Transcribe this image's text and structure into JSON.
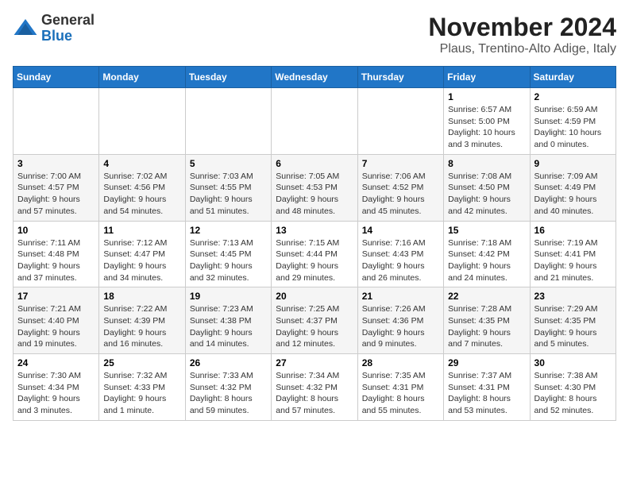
{
  "header": {
    "logo_general": "General",
    "logo_blue": "Blue",
    "month_title": "November 2024",
    "location": "Plaus, Trentino-Alto Adige, Italy"
  },
  "weekdays": [
    "Sunday",
    "Monday",
    "Tuesday",
    "Wednesday",
    "Thursday",
    "Friday",
    "Saturday"
  ],
  "weeks": [
    [
      {
        "day": "",
        "info": ""
      },
      {
        "day": "",
        "info": ""
      },
      {
        "day": "",
        "info": ""
      },
      {
        "day": "",
        "info": ""
      },
      {
        "day": "",
        "info": ""
      },
      {
        "day": "1",
        "info": "Sunrise: 6:57 AM\nSunset: 5:00 PM\nDaylight: 10 hours and 3 minutes."
      },
      {
        "day": "2",
        "info": "Sunrise: 6:59 AM\nSunset: 4:59 PM\nDaylight: 10 hours and 0 minutes."
      }
    ],
    [
      {
        "day": "3",
        "info": "Sunrise: 7:00 AM\nSunset: 4:57 PM\nDaylight: 9 hours and 57 minutes."
      },
      {
        "day": "4",
        "info": "Sunrise: 7:02 AM\nSunset: 4:56 PM\nDaylight: 9 hours and 54 minutes."
      },
      {
        "day": "5",
        "info": "Sunrise: 7:03 AM\nSunset: 4:55 PM\nDaylight: 9 hours and 51 minutes."
      },
      {
        "day": "6",
        "info": "Sunrise: 7:05 AM\nSunset: 4:53 PM\nDaylight: 9 hours and 48 minutes."
      },
      {
        "day": "7",
        "info": "Sunrise: 7:06 AM\nSunset: 4:52 PM\nDaylight: 9 hours and 45 minutes."
      },
      {
        "day": "8",
        "info": "Sunrise: 7:08 AM\nSunset: 4:50 PM\nDaylight: 9 hours and 42 minutes."
      },
      {
        "day": "9",
        "info": "Sunrise: 7:09 AM\nSunset: 4:49 PM\nDaylight: 9 hours and 40 minutes."
      }
    ],
    [
      {
        "day": "10",
        "info": "Sunrise: 7:11 AM\nSunset: 4:48 PM\nDaylight: 9 hours and 37 minutes."
      },
      {
        "day": "11",
        "info": "Sunrise: 7:12 AM\nSunset: 4:47 PM\nDaylight: 9 hours and 34 minutes."
      },
      {
        "day": "12",
        "info": "Sunrise: 7:13 AM\nSunset: 4:45 PM\nDaylight: 9 hours and 32 minutes."
      },
      {
        "day": "13",
        "info": "Sunrise: 7:15 AM\nSunset: 4:44 PM\nDaylight: 9 hours and 29 minutes."
      },
      {
        "day": "14",
        "info": "Sunrise: 7:16 AM\nSunset: 4:43 PM\nDaylight: 9 hours and 26 minutes."
      },
      {
        "day": "15",
        "info": "Sunrise: 7:18 AM\nSunset: 4:42 PM\nDaylight: 9 hours and 24 minutes."
      },
      {
        "day": "16",
        "info": "Sunrise: 7:19 AM\nSunset: 4:41 PM\nDaylight: 9 hours and 21 minutes."
      }
    ],
    [
      {
        "day": "17",
        "info": "Sunrise: 7:21 AM\nSunset: 4:40 PM\nDaylight: 9 hours and 19 minutes."
      },
      {
        "day": "18",
        "info": "Sunrise: 7:22 AM\nSunset: 4:39 PM\nDaylight: 9 hours and 16 minutes."
      },
      {
        "day": "19",
        "info": "Sunrise: 7:23 AM\nSunset: 4:38 PM\nDaylight: 9 hours and 14 minutes."
      },
      {
        "day": "20",
        "info": "Sunrise: 7:25 AM\nSunset: 4:37 PM\nDaylight: 9 hours and 12 minutes."
      },
      {
        "day": "21",
        "info": "Sunrise: 7:26 AM\nSunset: 4:36 PM\nDaylight: 9 hours and 9 minutes."
      },
      {
        "day": "22",
        "info": "Sunrise: 7:28 AM\nSunset: 4:35 PM\nDaylight: 9 hours and 7 minutes."
      },
      {
        "day": "23",
        "info": "Sunrise: 7:29 AM\nSunset: 4:35 PM\nDaylight: 9 hours and 5 minutes."
      }
    ],
    [
      {
        "day": "24",
        "info": "Sunrise: 7:30 AM\nSunset: 4:34 PM\nDaylight: 9 hours and 3 minutes."
      },
      {
        "day": "25",
        "info": "Sunrise: 7:32 AM\nSunset: 4:33 PM\nDaylight: 9 hours and 1 minute."
      },
      {
        "day": "26",
        "info": "Sunrise: 7:33 AM\nSunset: 4:32 PM\nDaylight: 8 hours and 59 minutes."
      },
      {
        "day": "27",
        "info": "Sunrise: 7:34 AM\nSunset: 4:32 PM\nDaylight: 8 hours and 57 minutes."
      },
      {
        "day": "28",
        "info": "Sunrise: 7:35 AM\nSunset: 4:31 PM\nDaylight: 8 hours and 55 minutes."
      },
      {
        "day": "29",
        "info": "Sunrise: 7:37 AM\nSunset: 4:31 PM\nDaylight: 8 hours and 53 minutes."
      },
      {
        "day": "30",
        "info": "Sunrise: 7:38 AM\nSunset: 4:30 PM\nDaylight: 8 hours and 52 minutes."
      }
    ]
  ]
}
